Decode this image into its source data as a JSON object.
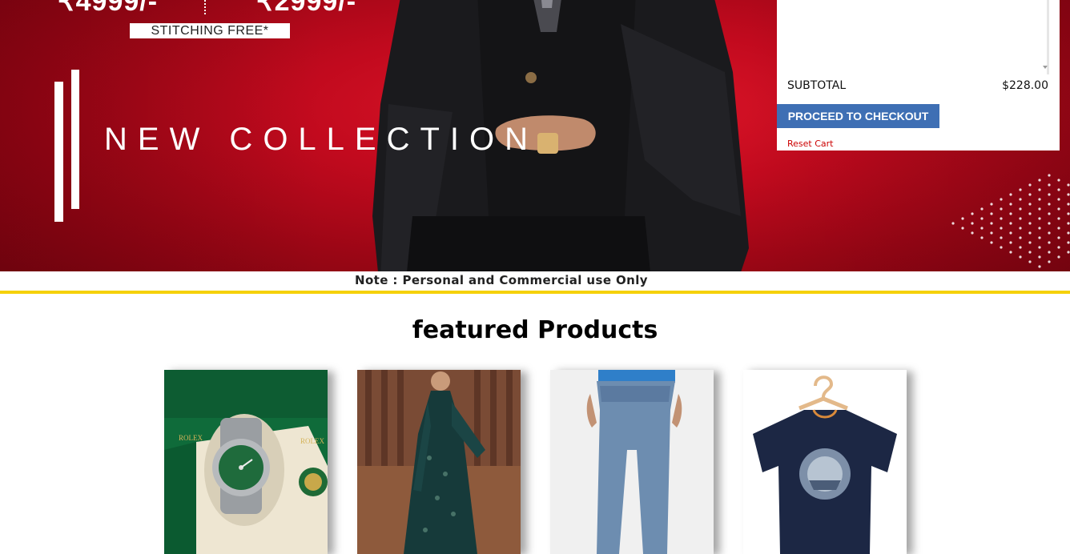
{
  "hero": {
    "price_left": "₹4999/-",
    "price_right": "₹2999/-",
    "stitching": "STITCHING FREE*",
    "headline": "NEW COLLECTION"
  },
  "cart": {
    "subtotal_label": "SUBTOTAL",
    "subtotal_value": "$228.00",
    "checkout_label": "PROCEED TO CHECKOUT",
    "reset_label": "Reset Cart"
  },
  "note": {
    "text": "Note : Personal and Commercial use Only"
  },
  "featured": {
    "title": "featured Products",
    "products": [
      {
        "image": "rolex-watch-image"
      },
      {
        "image": "green-ethnic-dress-image"
      },
      {
        "image": "blue-jeans-image"
      },
      {
        "image": "navy-tshirt-image"
      }
    ]
  },
  "colors": {
    "hero_red": "#c20a1e",
    "checkout_blue": "#3e6fb4",
    "note_yellow": "#f5d10a",
    "reset_red": "#cc0000"
  }
}
